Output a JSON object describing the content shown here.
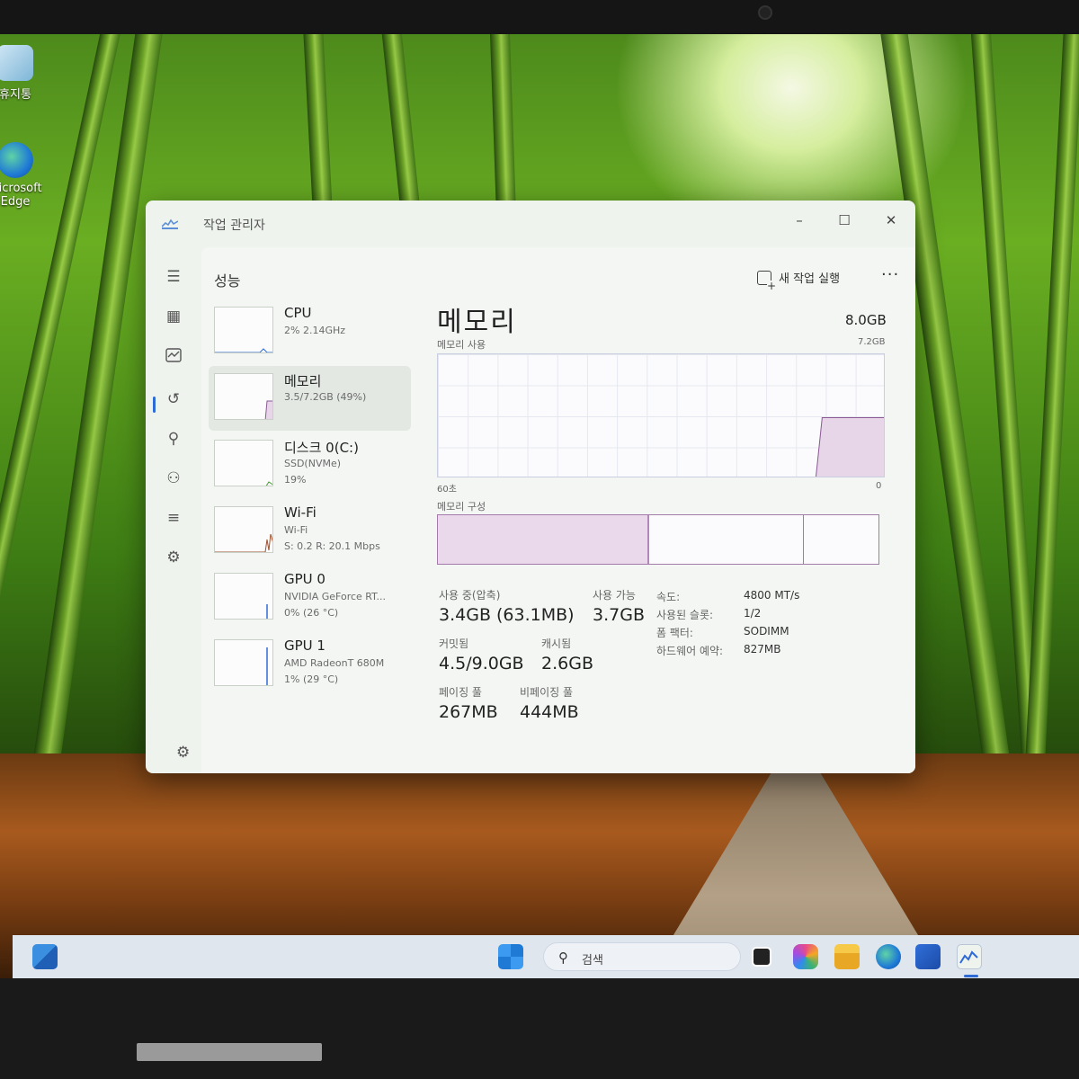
{
  "desktop": {
    "icons": [
      {
        "label": "휴지통",
        "icon": "recycle-bin-icon"
      },
      {
        "label": "Microsoft Edge",
        "icon": "edge-icon"
      }
    ]
  },
  "window": {
    "title": "작업 관리자",
    "controls": {
      "minimize": "–",
      "maximize": "☐",
      "close": "✕"
    }
  },
  "header": {
    "page_title": "성능",
    "run_task_label": "새 작업 실행",
    "more_label": "···"
  },
  "resources": [
    {
      "name": "CPU",
      "detail1": "2% 2.14GHz",
      "detail2": ""
    },
    {
      "name": "메모리",
      "detail1": "3.5/7.2GB (49%)",
      "detail2": ""
    },
    {
      "name": "디스크 0(C:)",
      "detail1": "SSD(NVMe)",
      "detail2": "19%"
    },
    {
      "name": "Wi-Fi",
      "detail1": "Wi-Fi",
      "detail2": "S: 0.2  R: 20.1 Mbps"
    },
    {
      "name": "GPU 0",
      "detail1": "NVIDIA GeForce RT...",
      "detail2": "0% (26 °C)"
    },
    {
      "name": "GPU 1",
      "detail1": "AMD RadeonT 680M",
      "detail2": "1% (29 °C)"
    }
  ],
  "memory": {
    "title": "메모리",
    "total": "8.0GB",
    "usage_label": "메모리 사용",
    "usage_max": "7.2GB",
    "axis_left": "60초",
    "axis_right": "0",
    "composition_label": "메모리 구성",
    "composition": {
      "in_use_fraction": 0.48,
      "modified_fraction": 0.83
    },
    "stats": {
      "in_use_label": "사용 중(압축)",
      "in_use_value": "3.4GB (63.1MB)",
      "available_label": "사용 가능",
      "available_value": "3.7GB",
      "committed_label": "커밋됨",
      "committed_value": "4.5/9.0GB",
      "cached_label": "캐시됨",
      "cached_value": "2.6GB",
      "paged_label": "페이징 풀",
      "paged_value": "267MB",
      "nonpaged_label": "비페이징 풀",
      "nonpaged_value": "444MB"
    },
    "details": [
      {
        "key": "속도:",
        "value": "4800 MT/s"
      },
      {
        "key": "사용된 슬롯:",
        "value": "1/2"
      },
      {
        "key": "폼 팩터:",
        "value": "SODIMM"
      },
      {
        "key": "하드웨어 예약:",
        "value": "827MB"
      }
    ]
  },
  "taskbar": {
    "search_label": "검색",
    "items": [
      "widgets-icon",
      "start-icon",
      "search-icon",
      "task-view-icon",
      "copilot-icon",
      "file-explorer-icon",
      "edge-icon",
      "store-icon",
      "task-manager-icon"
    ]
  },
  "colors": {
    "accent": "#2e6bd6",
    "memory_purple": "#8b5a94",
    "window_bg": "#eef3ee"
  }
}
